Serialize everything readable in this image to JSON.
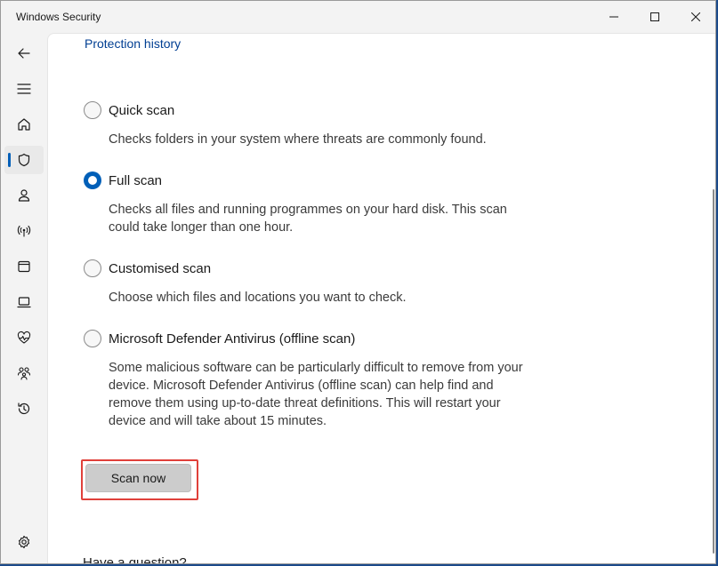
{
  "window": {
    "title": "Windows Security",
    "controls": [
      "minimize-icon",
      "maximize-icon",
      "close-icon"
    ]
  },
  "sidebar": {
    "items": [
      {
        "name": "back",
        "icon": "back-arrow-icon"
      },
      {
        "name": "menu",
        "icon": "hamburger-menu-icon"
      },
      {
        "name": "home",
        "icon": "home-icon"
      },
      {
        "name": "virus-protection",
        "icon": "shield-icon",
        "active": true
      },
      {
        "name": "account-protection",
        "icon": "person-icon"
      },
      {
        "name": "firewall-network",
        "icon": "wifi-antenna-icon"
      },
      {
        "name": "app-browser-control",
        "icon": "app-window-icon"
      },
      {
        "name": "device-security",
        "icon": "laptop-icon"
      },
      {
        "name": "device-performance",
        "icon": "heart-pulse-icon"
      },
      {
        "name": "family-options",
        "icon": "family-icon"
      },
      {
        "name": "protection-history",
        "icon": "history-icon"
      },
      {
        "name": "settings",
        "icon": "gear-icon"
      }
    ]
  },
  "main": {
    "protection_history_link": "Protection history",
    "scan_options": [
      {
        "label": "Quick scan",
        "description": "Checks folders in your system where threats are commonly found.",
        "checked": false
      },
      {
        "label": "Full scan",
        "description": "Checks all files and running programmes on your hard disk. This scan could take longer than one hour.",
        "checked": true
      },
      {
        "label": "Customised scan",
        "description": "Choose which files and locations you want to check.",
        "checked": false
      },
      {
        "label": "Microsoft Defender Antivirus (offline scan)",
        "description": "Some malicious software can be particularly difficult to remove from your device. Microsoft Defender Antivirus (offline scan) can help find and remove them using up-to-date threat definitions. This will restart your device and will take about 15 minutes.",
        "checked": false
      }
    ],
    "scan_button_label": "Scan now",
    "question_heading": "Have a question?"
  },
  "colors": {
    "accent": "#005fb8",
    "highlight_border": "#e0403a",
    "link": "#003e92"
  }
}
